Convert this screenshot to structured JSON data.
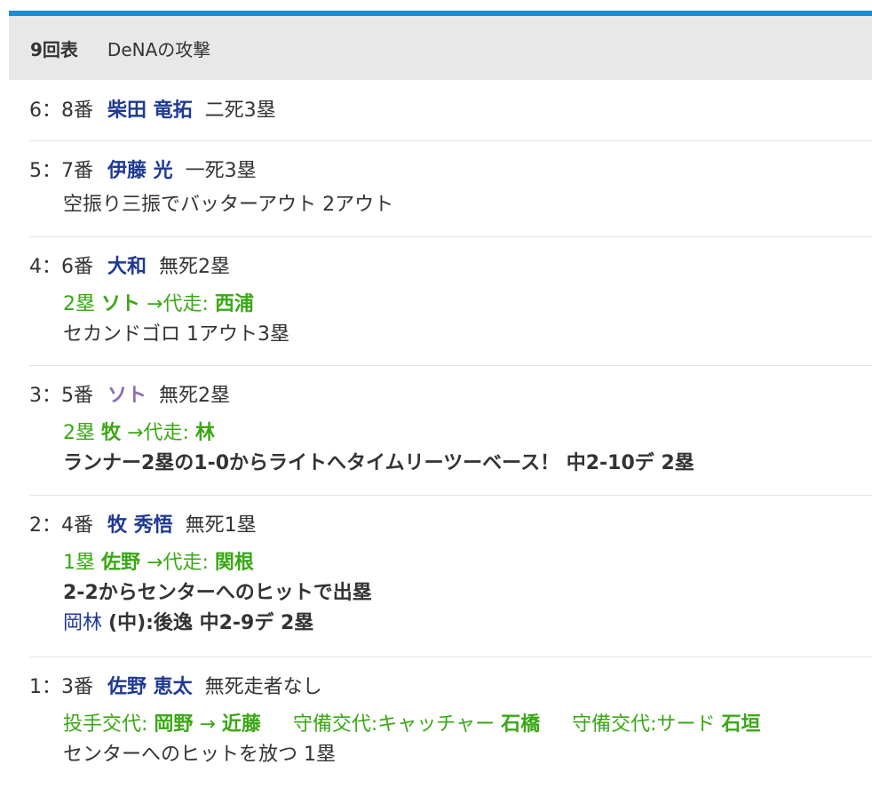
{
  "header": {
    "inning": "9回表",
    "team_attack": "DeNAの攻撃"
  },
  "entries": [
    {
      "no": "6：8番",
      "player": "柴田 竜拓",
      "situation": "二死3塁"
    },
    {
      "no": "5：7番",
      "player": "伊藤 光",
      "situation": "一死3塁",
      "result": "空振り三振でバッターアウト 2アウト"
    },
    {
      "no": "4：6番",
      "player": "大和",
      "situation": "無死2塁",
      "runner_base": "2塁",
      "runner_name": "ソト",
      "runner_arrow": "→代走:",
      "runner_sub": "西浦",
      "result": "セカンドゴロ 1アウト3塁"
    },
    {
      "no": "3：5番",
      "player": "ソト",
      "situation": "無死2塁",
      "runner_base": "2塁",
      "runner_name": "牧",
      "runner_arrow": "→代走:",
      "runner_sub": "林",
      "result": "ランナー2塁の1-0からライトへタイムリーツーベース！ 中2-10デ 2塁"
    },
    {
      "no": "2：4番",
      "player": "牧 秀悟",
      "situation": "無死1塁",
      "runner_base": "1塁",
      "runner_name": "佐野",
      "runner_arrow": "→代走:",
      "runner_sub": "関根",
      "result": "2-2からセンターへのヒットで出塁",
      "pitcher_link": "岡林",
      "pitcher_result": "(中):後逸 中2-9デ 2塁"
    },
    {
      "no": "1：3番",
      "player": "佐野 恵太",
      "situation": "無死走者なし",
      "change1_label": "投手交代:",
      "change1_from": "岡野",
      "change1_arrow": "→",
      "change1_to": "近藤",
      "change2_label": "守備交代:キャッチャー",
      "change2_name": "石橋",
      "change3_label": "守備交代:サード",
      "change3_name": "石垣",
      "result": "センターへのヒットを放つ 1塁"
    }
  ]
}
